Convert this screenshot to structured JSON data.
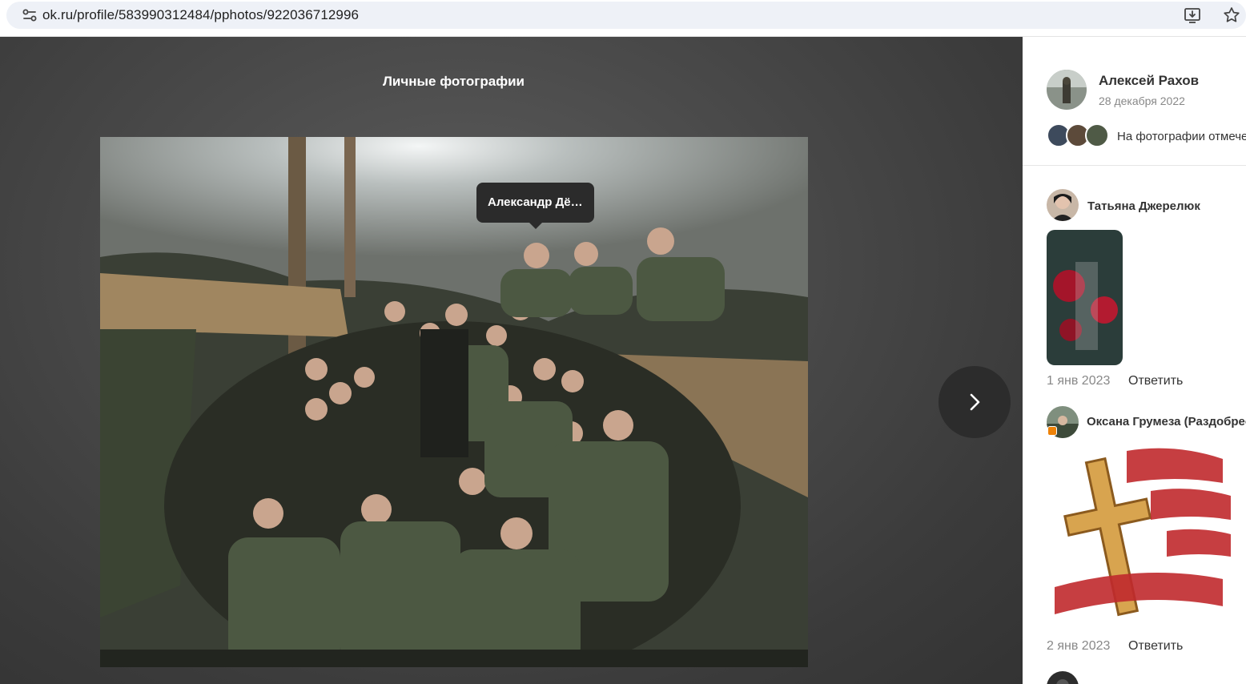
{
  "browser": {
    "url": "ok.ru/profile/583990312484/pphotos/922036712996",
    "icons": [
      "site-info-icon",
      "install-icon",
      "bookmark-star-icon"
    ]
  },
  "viewer": {
    "album_title": "Личные фотографии",
    "tag_tooltip": "Александр Дё…",
    "next_icon": "chevron-right-icon"
  },
  "sidebar": {
    "author": {
      "name": "Алексей Рахов",
      "date": "28 декабря 2022"
    },
    "tagged_text": "На фотографии отмечены",
    "comments": [
      {
        "name": "Татьяна Джерелюк",
        "date": "1 янв 2023",
        "reply": "Ответить"
      },
      {
        "name": "Оксана Грумеза (Раздобреева)",
        "date": "2 янв 2023",
        "reply": "Ответить"
      }
    ]
  },
  "colors": {
    "viewer_bg": "#4a4a4a",
    "tooltip_bg": "#2b2b2b",
    "next_button_bg": "#2c2c2c",
    "badge_orange": "#ee8208"
  }
}
